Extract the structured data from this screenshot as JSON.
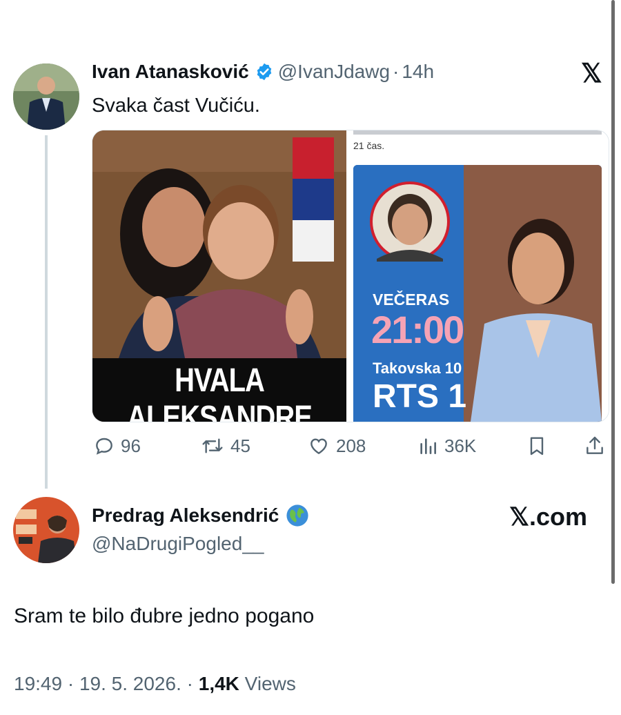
{
  "tweet": {
    "author_name": "Ivan Atanasković",
    "handle": "@IvanJdawg",
    "separator": "·",
    "time": "14h",
    "text": "Svaka čast Vučiću.",
    "media": {
      "left_caption": "HVALA ALEKSANDRE",
      "right_top_text": "21 čas.",
      "vecer_label": "VEČERAS",
      "time_label": "21:00",
      "address": "Takovska 10",
      "channel": "RTS 1"
    },
    "actions": {
      "replies": "96",
      "retweets": "45",
      "likes": "208",
      "views": "36K"
    }
  },
  "reply": {
    "author_name": "Predrag Aleksendrić",
    "handle": "@NaDrugiPogled__",
    "text": "Sram te bilo đubre jedno pogano",
    "meta_time": "19:49 · 19. 5. 2026. · ",
    "meta_views_count": "1,4K",
    "meta_views_label": " Views"
  },
  "brand": {
    "x_logo": "𝕏",
    "x_com": "𝕏.com"
  },
  "colors": {
    "verified": "#1d9bf0",
    "muted": "#536471",
    "pink": "#f5a3b5",
    "rts_blue": "#1f5fae"
  }
}
